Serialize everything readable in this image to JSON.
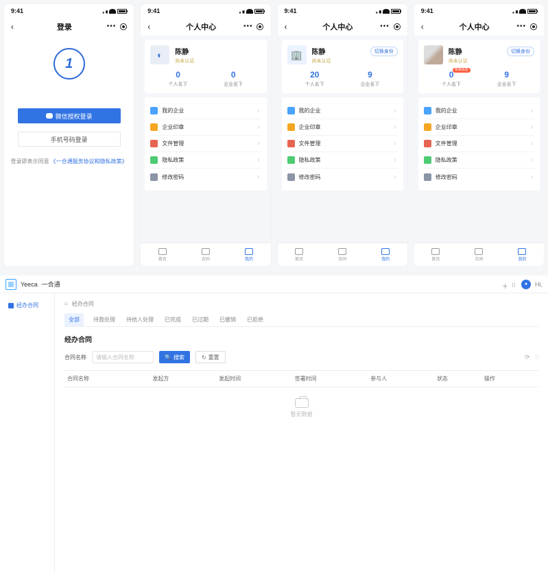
{
  "status_time": "9:41",
  "phone_login": {
    "title": "登录",
    "wechat_btn": "微信授权登录",
    "phone_btn": "手机号码登录",
    "terms_prefix": "登录即表示同意",
    "terms_link": "《一合通服务协议和隐私政策》"
  },
  "profile": {
    "title": "个人中心",
    "name": "陈静",
    "sub": "尚未认证",
    "switch": "切换身份",
    "stat_personal_label": "个人名下",
    "stat_corp_label": "企业名下",
    "unread_badge": "未读消息"
  },
  "phone2_stats": {
    "p": "0",
    "c": "0"
  },
  "phone3_stats": {
    "p": "20",
    "c": "9"
  },
  "phone4_stats": {
    "p": "0",
    "c": "9"
  },
  "menu": [
    {
      "icon": "ic-blue",
      "label": "我的企业"
    },
    {
      "icon": "ic-orange",
      "label": "企业印章"
    },
    {
      "icon": "ic-red",
      "label": "文件管理"
    },
    {
      "icon": "ic-green",
      "label": "隐私政策"
    },
    {
      "icon": "ic-grey",
      "label": "修改密码"
    }
  ],
  "tabs": [
    {
      "label": "首页"
    },
    {
      "label": "合同"
    },
    {
      "label": "我的"
    }
  ],
  "desktop": {
    "brand": "Yeeca",
    "brand_cn": "一合通",
    "side_item": "经办合同",
    "crumb_root": "⌂",
    "crumb_current": "经办合同",
    "tabs": [
      "全部",
      "待我处理",
      "待他人处理",
      "已完成",
      "已过期",
      "已撤销",
      "已拒绝"
    ],
    "section_title": "经办合同",
    "filter_label": "合同名称",
    "filter_placeholder": "请输入合同名称",
    "search_btn": "搜索",
    "reset_btn": "重置",
    "columns": [
      "合同名称",
      "发起方",
      "发起时间",
      "签署时间",
      "参与人",
      "状态",
      "操作"
    ],
    "empty_text": "暂无数据",
    "header_hi": "Hi,"
  }
}
